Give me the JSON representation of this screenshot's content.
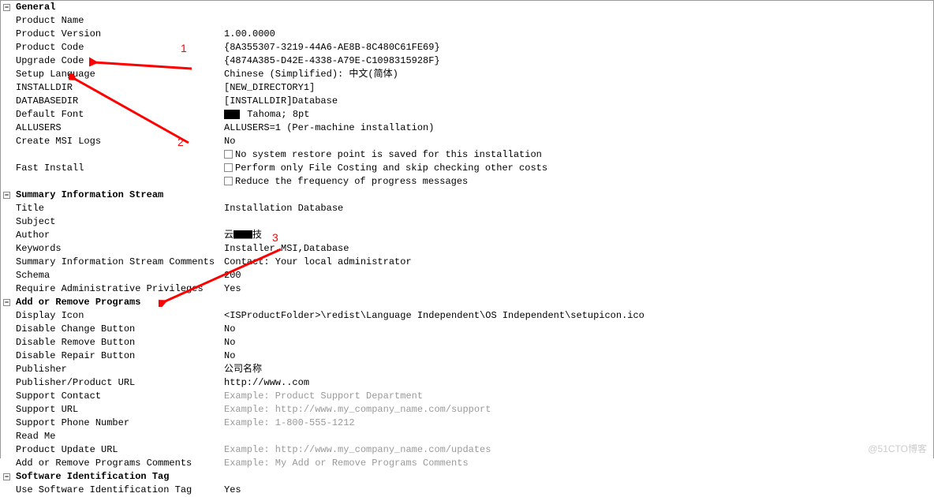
{
  "sections": {
    "general": {
      "header": "General",
      "rows": {
        "product_name": {
          "label": "Product Name",
          "value": ""
        },
        "product_version": {
          "label": "Product Version",
          "value": "1.00.0000"
        },
        "product_code": {
          "label": "Product Code",
          "value": "{8A355307-3219-44A6-AE8B-8C480C61FE69}"
        },
        "upgrade_code": {
          "label": "Upgrade Code",
          "value": "{4874A385-D42E-4338-A79E-C1098315928F}"
        },
        "setup_language": {
          "label": "Setup Language",
          "value": "Chinese (Simplified): 中文(简体)"
        },
        "installdir": {
          "label": "INSTALLDIR",
          "value": "[NEW_DIRECTORY1]"
        },
        "databasedir": {
          "label": "DATABASEDIR",
          "value": "[INSTALLDIR]Database"
        },
        "default_font": {
          "label": "Default Font",
          "value": "Tahoma; 8pt"
        },
        "allusers": {
          "label": "ALLUSERS",
          "value": "ALLUSERS=1 (Per-machine installation)"
        },
        "create_msi_logs": {
          "label": "Create MSI Logs",
          "value": "No"
        },
        "fast_install": {
          "label": "Fast Install",
          "opts": [
            "No system restore point is saved for this installation",
            "Perform only File Costing and skip checking other costs",
            "Reduce the frequency of progress messages"
          ]
        }
      }
    },
    "summary": {
      "header": "Summary Information Stream",
      "rows": {
        "title": {
          "label": "Title",
          "value": "Installation Database"
        },
        "subject": {
          "label": "Subject",
          "value": ""
        },
        "author": {
          "label": "Author",
          "value": "云▇▇技"
        },
        "keywords": {
          "label": "Keywords",
          "value": "Installer,MSI,Database"
        },
        "comments": {
          "label": "Summary Information Stream Comments",
          "value": "Contact:  Your local administrator"
        },
        "schema": {
          "label": "Schema",
          "value": "200"
        },
        "require_admin": {
          "label": "Require Administrative Privileges",
          "value": "Yes"
        }
      }
    },
    "arp": {
      "header": "Add or Remove Programs",
      "rows": {
        "display_icon": {
          "label": "Display Icon",
          "value": "<ISProductFolder>\\redist\\Language Independent\\OS Independent\\setupicon.ico"
        },
        "disable_change": {
          "label": "Disable Change Button",
          "value": "No"
        },
        "disable_remove": {
          "label": "Disable Remove Button",
          "value": "No"
        },
        "disable_repair": {
          "label": "Disable Repair Button",
          "value": "No"
        },
        "publisher": {
          "label": "Publisher",
          "value": "公司名称"
        },
        "publisher_url": {
          "label": "Publisher/Product URL",
          "value": "http://www..com"
        },
        "support_contact": {
          "label": "Support Contact",
          "placeholder": "Example: Product Support Department"
        },
        "support_url": {
          "label": "Support URL",
          "placeholder": "Example: http://www.my_company_name.com/support"
        },
        "support_phone": {
          "label": "Support Phone Number",
          "placeholder": "Example: 1-800-555-1212"
        },
        "read_me": {
          "label": "Read Me",
          "value": ""
        },
        "product_update_url": {
          "label": "Product Update URL",
          "placeholder": "Example: http://www.my_company_name.com/updates"
        },
        "arp_comments": {
          "label": "Add or Remove Programs Comments",
          "placeholder": "Example: My Add or Remove Programs Comments"
        }
      }
    },
    "swid": {
      "header": "Software Identification Tag",
      "rows": {
        "use_tag": {
          "label": "Use Software Identification Tag",
          "value": "Yes"
        }
      }
    }
  },
  "annotations": {
    "a1": "1",
    "a2": "2",
    "a3": "3"
  },
  "watermark": "@51CTO博客"
}
